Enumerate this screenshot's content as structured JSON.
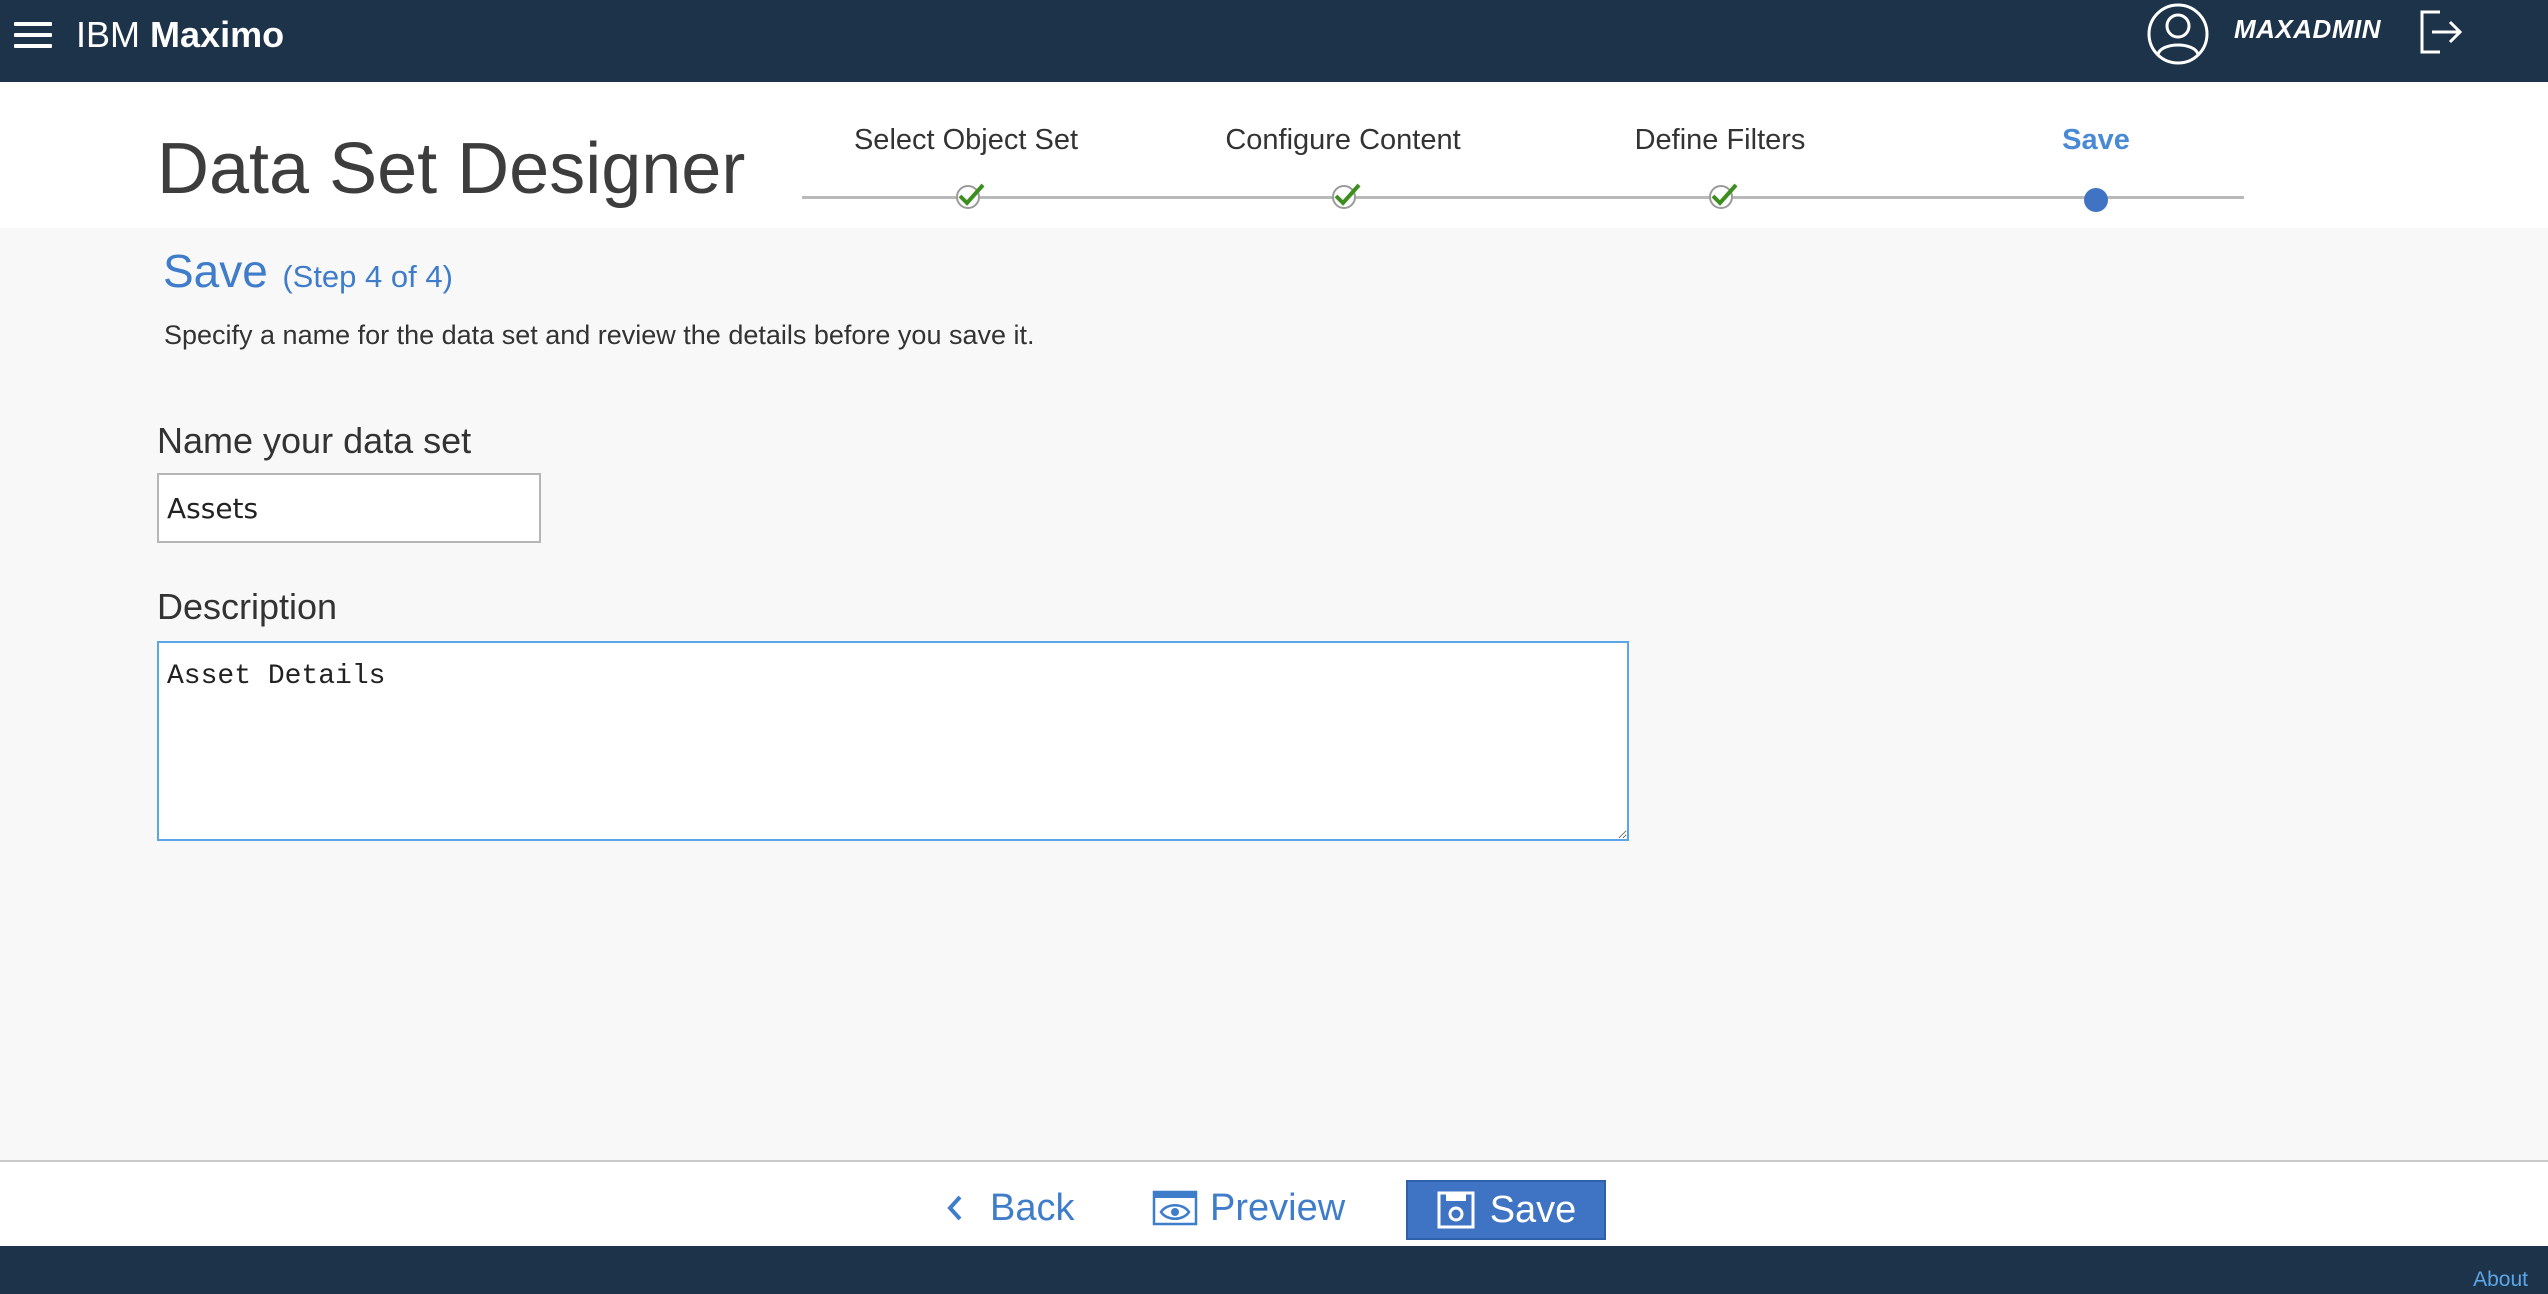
{
  "header": {
    "brand_prefix": "IBM",
    "brand_name": "Maximo",
    "username": "MAXADMIN",
    "icons": {
      "menu": "hamburger-icon",
      "avatar": "user-avatar-icon",
      "logout": "logout-icon"
    }
  },
  "page": {
    "title": "Data Set Designer"
  },
  "stepper": {
    "steps": [
      {
        "label": "Select Object Set",
        "status": "complete"
      },
      {
        "label": "Configure Content",
        "status": "complete"
      },
      {
        "label": "Define Filters",
        "status": "complete"
      },
      {
        "label": "Save",
        "status": "current"
      }
    ]
  },
  "content": {
    "heading": "Save",
    "step_indicator": "(Step 4 of 4)",
    "instructions": "Specify a name for the data set and review the details before you save it.",
    "name_label": "Name your data set",
    "name_value": "Assets",
    "description_label": "Description",
    "description_value": "Asset Details"
  },
  "actions": {
    "back_label": "Back",
    "preview_label": "Preview",
    "save_label": "Save"
  },
  "footer": {
    "about_label": "About"
  },
  "colors": {
    "header_bg": "#1d3349",
    "accent": "#3f7dcb",
    "primary_button": "#3f73c3",
    "check_green": "#3e8e1f"
  }
}
